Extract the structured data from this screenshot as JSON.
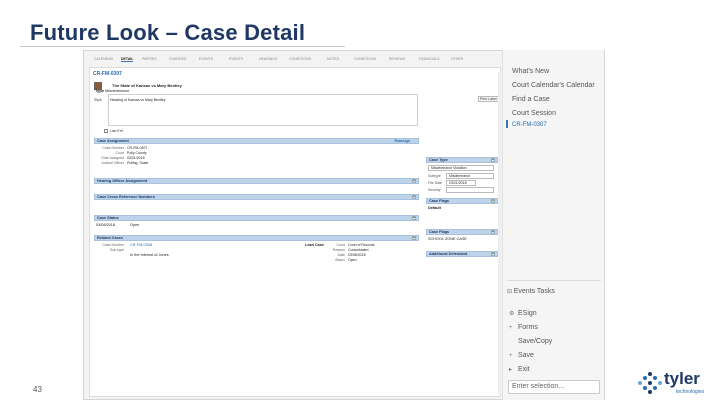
{
  "slide": {
    "title": "Future Look – Case Detail",
    "page_number": "43"
  },
  "app": {
    "tabs": [
      "Calendar",
      "Detail",
      "Parties",
      "Charges",
      "Events",
      "Events",
      "Hearings",
      "Conditions",
      "Notes",
      "Conditions",
      "Reviews",
      "Financials",
      "Other"
    ],
    "case_number": "CR-FM-0307",
    "style": "The State of Kansas vs Mary Bentley",
    "type_label": "Type",
    "type_value": "Misdemeanor",
    "style_field_label": "Style",
    "style_field_value": "Heading of Kansas vs Mary Bentley",
    "print_label": "Print Label",
    "check_label": "Law Enf.",
    "sections": {
      "case_assignment": "Case Assignment",
      "case_assignment_link": "Reassign",
      "hearing_officer": "Hearing Officer Assignment",
      "cross_reference": "Case Cross Reference Numbers",
      "case_status": "Case Status",
      "related_cases": "Related Cases",
      "case_type": "Case Type",
      "case_flags": "Case Flags",
      "case_flags2": "Case Flags",
      "additional_defendant": "Additional Defendant"
    },
    "assignment": [
      {
        "k": "Case Number",
        "v": "CR-FM-0307"
      },
      {
        "k": "Court",
        "v": "Polly County"
      },
      {
        "k": "Date Assigned",
        "v": "03/21/2018"
      },
      {
        "k": "Judicial Officer",
        "v": "Pulling, Susie"
      }
    ],
    "case_type_rows": [
      {
        "k": "Subtype",
        "v": "Misdemeanor"
      },
      {
        "k": "File Date",
        "v": "03/21/2018"
      },
      {
        "k": "Severity",
        "v": ""
      }
    ],
    "case_type_value": "Misdemeanor Violation",
    "flags_value": "Default",
    "flags2_value": "SCHOOL ZONE CASE",
    "status_date": "03/08/2018",
    "status_value": "Open",
    "related": {
      "case_number_label": "Case Number",
      "case_number": "CR-FM-0308",
      "sub_label": "Sub-type",
      "sub_value": "In the Interest of Jones",
      "lead_label": "Lead Case",
      "court_label": "Court",
      "court_value": "Court of Records",
      "reason_label": "Reason",
      "reason_value": "Consolidated",
      "date_label": "Date",
      "date_value": "03/08/2018",
      "status_label": "Status",
      "status_value": "Open"
    }
  },
  "nav": {
    "items": [
      "What's New",
      "Court Calendar's Calendar",
      "Find a Case",
      "Court Session"
    ],
    "current_case": "CR-FM-0307",
    "events_tasks": "Events Tasks",
    "actions": [
      {
        "icon": "esign-icon",
        "glyph": "⚙",
        "label": "ESign"
      },
      {
        "icon": "forms-icon",
        "glyph": "+",
        "label": "Forms"
      },
      {
        "icon": "",
        "glyph": "",
        "label": "Save/Copy"
      },
      {
        "icon": "save-icon",
        "glyph": "+",
        "label": "Save"
      },
      {
        "icon": "exit-icon",
        "glyph": "▸",
        "label": "Exit"
      }
    ],
    "enter_placeholder": "Enter selection..."
  },
  "logo": {
    "name": "tyler",
    "sub": "technologies",
    "colors": [
      "#1f3864",
      "#2b6cb0",
      "#6aa6d9"
    ]
  }
}
